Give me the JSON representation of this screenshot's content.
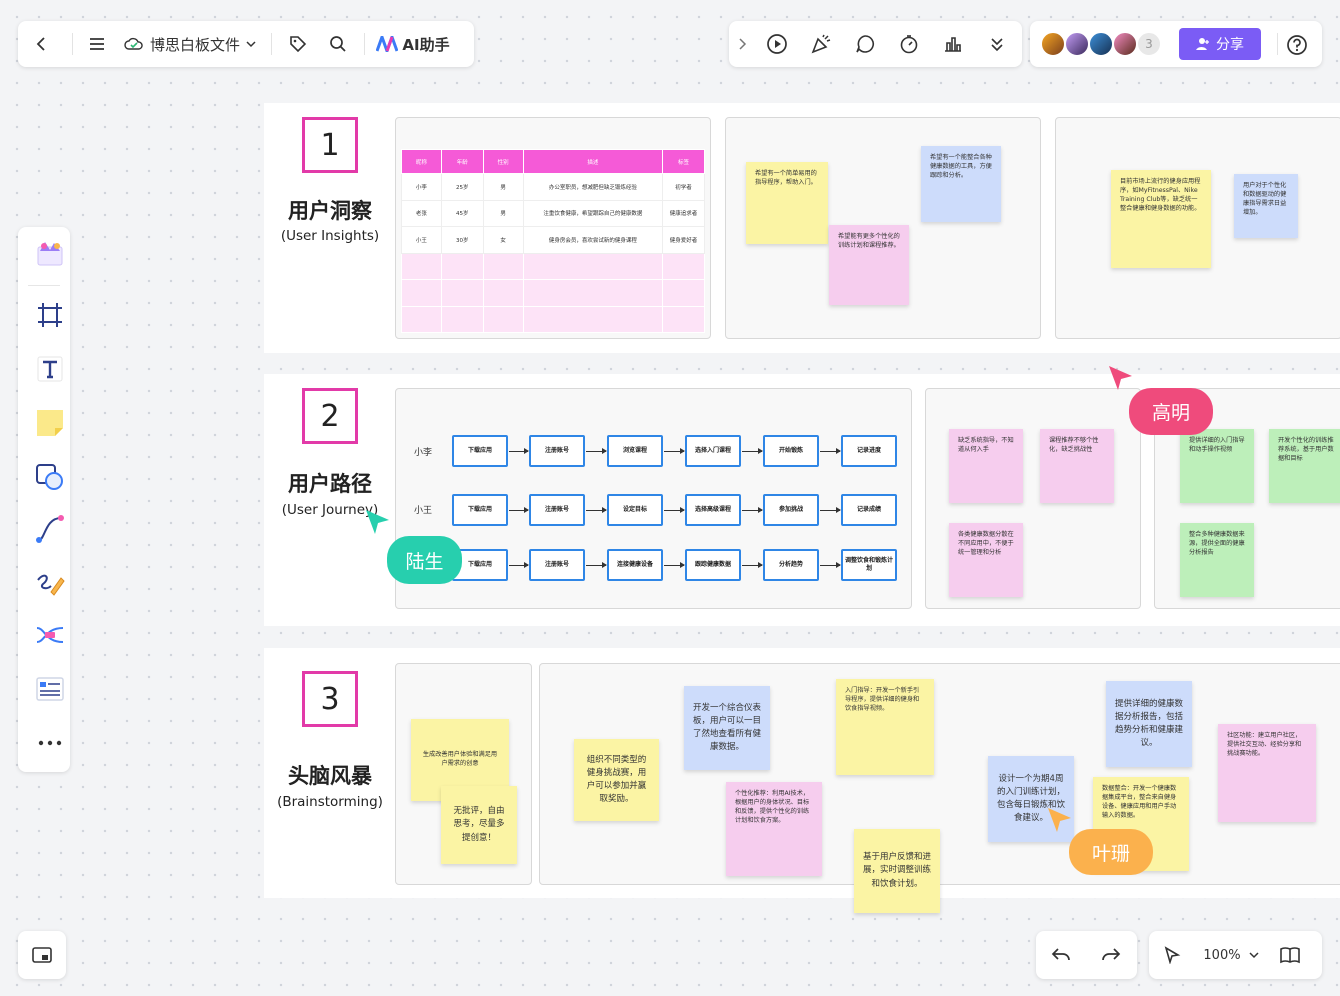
{
  "header": {
    "file_name": "博思白板文件",
    "ai_label": "AI助手",
    "collaborator_count": "3",
    "share_label": "分享"
  },
  "bottom_bar": {
    "zoom": "100%"
  },
  "sections": [
    {
      "number": "1",
      "title": "用户洞察",
      "subtitle": "(User Insights)"
    },
    {
      "number": "2",
      "title": "用户路径",
      "subtitle": "(User Journey)"
    },
    {
      "number": "3",
      "title": "头脑风暴",
      "subtitle": "(Brainstorming)"
    }
  ],
  "insight_table": {
    "headers": [
      "昵称",
      "年龄",
      "性别",
      "描述",
      "标签"
    ],
    "rows": [
      [
        "小李",
        "25岁",
        "男",
        "办公室职员，想减肥但缺乏锻炼经验",
        "初学者"
      ],
      [
        "老张",
        "45岁",
        "男",
        "注重饮食健康，希望跟踪自己的健康数据",
        "健康追求者"
      ],
      [
        "小王",
        "30岁",
        "女",
        "健身房会员，喜欢尝试新的健身课程",
        "健身爱好者"
      ]
    ]
  },
  "insight_notes": {
    "n1": "希望有一个简单易用的指导程序，帮助入门。",
    "n2": "希望有一个能整合各种健康数据的工具，方便跟踪和分析。",
    "n3": "希望能有更多个性化的训练计划和课程推荐。",
    "n4": "目前市场上流行的健身应用程序，如MyFitnessPal、Nike Training Club等，缺乏统一整合健康和健身数据的功能。",
    "n5": "用户对于个性化和数据驱动的健康指导需求日益增加。"
  },
  "journey": {
    "rows": [
      {
        "label": "小李",
        "steps": [
          "下载应用",
          "注册账号",
          "浏览课程",
          "选择入门课程",
          "开始锻炼",
          "记录进度"
        ]
      },
      {
        "label": "小王",
        "steps": [
          "下载应用",
          "注册账号",
          "设定目标",
          "选择高级课程",
          "参加挑战",
          "记录成绩"
        ]
      },
      {
        "label": "",
        "steps": [
          "下载应用",
          "注册账号",
          "连接健康设备",
          "跟踪健康数据",
          "分析趋势",
          "调整饮食和锻炼计划"
        ]
      }
    ],
    "notes": {
      "p1": "缺乏系统指导，不知道从何入手",
      "p2": "课程推荐不够个性化，缺乏挑战性",
      "p3": "各类健康数据分散在不同应用中，不便于统一管理和分析",
      "g1": "提供详细的入门指导和动手操作视频",
      "g2": "开发个性化的训练推荐系统，基于用户数据和目标",
      "g3": "整合多种健康数据来源，提供全面的健康分析报告"
    }
  },
  "brainstorm_notes": {
    "b1": "生成改善用户体验和满足用户需求的创意",
    "b2": "无批评，自由思考，尽量多提创意！",
    "b3": "组织不同类型的健身挑战赛，用户可以参加并赢取奖励。",
    "b4": "开发一个综合仪表板，用户可以一目了然地查看所有健康数据。",
    "b5": "个性化推荐：利用AI技术，根据用户的身体状况、目标和反馈，提供个性化的训练计划和饮食方案。",
    "b6": "入门指导：开发一个新手引导程序，提供详细的健身和饮食指导视频。",
    "b7": "基于用户反馈和进展，实时调整训练和饮食计划。",
    "b8": "设计一个为期4周的入门训练计划，包含每日锻炼和饮食建议。",
    "b9": "提供详细的健康数据分析报告，包括趋势分析和健康建议。",
    "b10": "数据整合：开发一个健康数据集成平台，整合来自健身设备、健康应用和用户手动输入的数据。",
    "b11": "社区功能：建立用户社区，提供社交互动、经验分享和挑战赛功能。"
  },
  "cursors": [
    {
      "name": "高明",
      "color": "#ef4b7c"
    },
    {
      "name": "陆生",
      "color": "#27cfae"
    },
    {
      "name": "叶珊",
      "color": "#fbb14d"
    }
  ],
  "colors": {
    "accent": "#7b5cf5",
    "section_border": "#e23aa8",
    "table_header": "#f55ad7",
    "flow_border": "#2f86e6"
  }
}
